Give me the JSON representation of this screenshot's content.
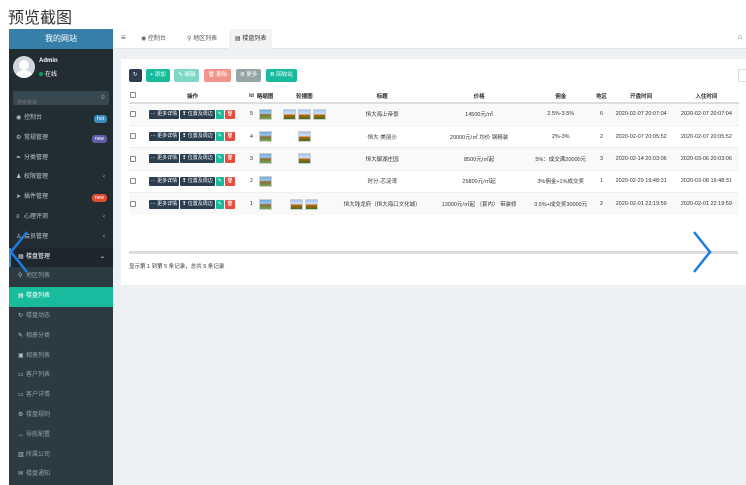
{
  "preview_title": "预览截图",
  "brand": "我的网站",
  "user": {
    "name": "Admin",
    "status": "在线"
  },
  "search": {
    "placeholder": "搜索菜单"
  },
  "menu": [
    {
      "label": "控制台",
      "icon": "dashboard-icon",
      "glyph": "◉",
      "badge": "hot",
      "badge_color": "#3c8dbc"
    },
    {
      "label": "常规管理",
      "icon": "cogs-icon",
      "glyph": "⚙",
      "badge": "new",
      "badge_color": "#605ca8"
    },
    {
      "label": "分类管理",
      "icon": "leaf-icon",
      "glyph": "❧"
    },
    {
      "label": "权限管理",
      "icon": "group-icon",
      "glyph": "♟",
      "arrow": "‹"
    },
    {
      "label": "插件管理",
      "icon": "rocket-icon",
      "glyph": "➤",
      "badge": "new",
      "badge_color": "#dd4b39"
    },
    {
      "label": "心理评测",
      "icon": "list-icon",
      "glyph": "≡",
      "arrow": "‹"
    },
    {
      "label": "会员管理",
      "icon": "user-icon",
      "glyph": "♙",
      "arrow": "‹"
    },
    {
      "label": "楼盘管理",
      "icon": "building-icon",
      "glyph": "▦",
      "arrow": "⌄",
      "open": true
    },
    {
      "label": "地区列表",
      "icon": "map-marker-icon",
      "glyph": "⚲",
      "sub": true
    },
    {
      "label": "楼盘列表",
      "icon": "list-alt-icon",
      "glyph": "▤",
      "sub": true,
      "active": true
    },
    {
      "label": "楼盘动态",
      "icon": "refresh-icon",
      "glyph": "↻",
      "sub": true
    },
    {
      "label": "相册分类",
      "icon": "tags-icon",
      "glyph": "✎",
      "sub": true
    },
    {
      "label": "相册列表",
      "icon": "image-icon",
      "glyph": "▣",
      "sub": true
    },
    {
      "label": "客户列表",
      "icon": "id-card-icon",
      "glyph": "▭",
      "sub": true
    },
    {
      "label": "客户详情",
      "icon": "vcard-icon",
      "glyph": "▭",
      "sub": true
    },
    {
      "label": "楼盘规则",
      "icon": "gear-icon",
      "glyph": "⚙",
      "sub": true
    },
    {
      "label": "导航配置",
      "icon": "arrows-icon",
      "glyph": "↔",
      "sub": true
    },
    {
      "label": "所属公司",
      "icon": "bank-icon",
      "glyph": "▥",
      "sub": true
    },
    {
      "label": "楼盘通知",
      "icon": "bell-icon",
      "glyph": "✉",
      "sub": true
    }
  ],
  "topbar": {
    "tabs": [
      {
        "label": "控制台",
        "glyph": "◉"
      },
      {
        "label": "地区列表",
        "glyph": "⚲"
      },
      {
        "label": "楼盘列表",
        "glyph": "▤",
        "active": true
      }
    ]
  },
  "toolbar": {
    "refresh_glyph": "↻",
    "add": "+ 添加",
    "edit": "✎ 编辑",
    "delete": "🗑 删除",
    "more": "⚙ 更多",
    "recycle": "♻ 回收站"
  },
  "table": {
    "headers": [
      "操作",
      "Id",
      "略缩图",
      "轮播图",
      "标题",
      "价格",
      "佣金",
      "地区",
      "开盘时间",
      "入住时间"
    ],
    "action_labels": {
      "more": "⋯ 更多详情",
      "location": "❢ 位置及周边"
    },
    "rows": [
      {
        "id": "5",
        "carousel": 3,
        "title": "恒大海上帝景",
        "price": "14500元/㎡",
        "commission": "2.5%-3.5%",
        "region": "6",
        "open": "2020-02-07 20:07:04",
        "checkin": "2020-02-07 20:07:04"
      },
      {
        "id": "4",
        "carousel": 1,
        "title": "恒大·美丽沙",
        "price": "20000元/㎡ 均价 钢精装",
        "commission": "2%-3%",
        "region": "2",
        "open": "2020-02-07 20:05:52",
        "checkin": "2020-02-07 20:05:52"
      },
      {
        "id": "3",
        "carousel": 1,
        "title": "恒大御湖庄园",
        "price": "8500元/㎡起",
        "commission": "5%：成交满20000元",
        "region": "3",
        "open": "2020-02-14 20:03:06",
        "checkin": "2020-03-06 20:03:06"
      },
      {
        "id": "2",
        "carousel": 0,
        "title": "时分·芯淀湾",
        "price": "25800元/㎡起",
        "commission": "3%佣金+1%成交奖",
        "region": "1",
        "open": "2020-02-29 19:48:31",
        "checkin": "2020-03-08 19:48:31"
      },
      {
        "id": "1",
        "carousel": 2,
        "title": "恒大钱龙府（恒大海口文化城）",
        "price": "13000元/㎡起 （套内） 带装修",
        "commission": "3.5%+成交奖30000元",
        "region": "2",
        "open": "2020-02-01 22:19:59",
        "checkin": "2020-02-01 22:19:59"
      }
    ]
  },
  "footer": "显示第 1 到第 5 条记录，总共 5 条记录",
  "nav": {
    "prev": "chevron-left-icon",
    "next": "chevron-right-icon",
    "color": "#1e7be6"
  }
}
